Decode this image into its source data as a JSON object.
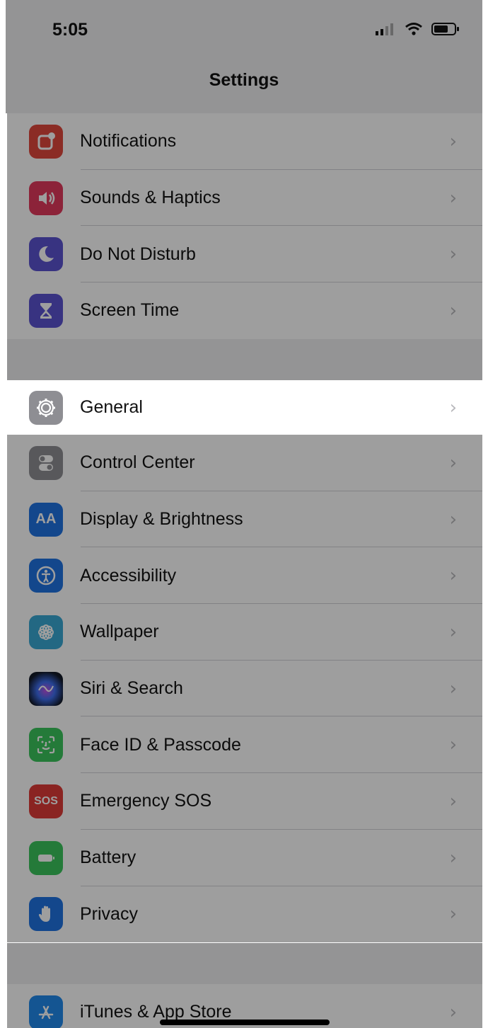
{
  "status_bar": {
    "time": "5:05"
  },
  "nav": {
    "title": "Settings"
  },
  "group1": [
    {
      "label": "Notifications",
      "icon": "notifications-icon",
      "color": "#e6453a"
    },
    {
      "label": "Sounds & Haptics",
      "icon": "speaker-icon",
      "color": "#e8365b"
    },
    {
      "label": "Do Not Disturb",
      "icon": "moon-icon",
      "color": "#5b52d6"
    },
    {
      "label": "Screen Time",
      "icon": "hourglass-icon",
      "color": "#5b52d6"
    }
  ],
  "general": {
    "label": "General",
    "icon": "gear-icon",
    "color": "#8e8e93"
  },
  "group2": [
    {
      "label": "Control Center",
      "icon": "toggles-icon",
      "color": "#8e8e93"
    },
    {
      "label": "Display & Brightness",
      "icon": "aa-icon",
      "color": "#1b73e8",
      "icon_text": "AA"
    },
    {
      "label": "Accessibility",
      "icon": "accessibility-icon",
      "color": "#1b73e8"
    },
    {
      "label": "Wallpaper",
      "icon": "flower-icon",
      "color": "#34a9d6"
    },
    {
      "label": "Siri & Search",
      "icon": "siri-icon",
      "color": "#111827"
    },
    {
      "label": "Face ID & Passcode",
      "icon": "face-id-icon",
      "color": "#34c759"
    },
    {
      "label": "Emergency SOS",
      "icon": "sos-icon",
      "color": "#e53935",
      "icon_text": "SOS"
    },
    {
      "label": "Battery",
      "icon": "battery-icon",
      "color": "#34c759"
    },
    {
      "label": "Privacy",
      "icon": "hand-icon",
      "color": "#1b73e8"
    }
  ],
  "group3": [
    {
      "label": "iTunes & App Store",
      "icon": "app-store-icon",
      "color": "#1b8af2"
    }
  ],
  "chevron": "›",
  "colors": {
    "background": "#efeff1",
    "highlight": "#ffffff"
  }
}
